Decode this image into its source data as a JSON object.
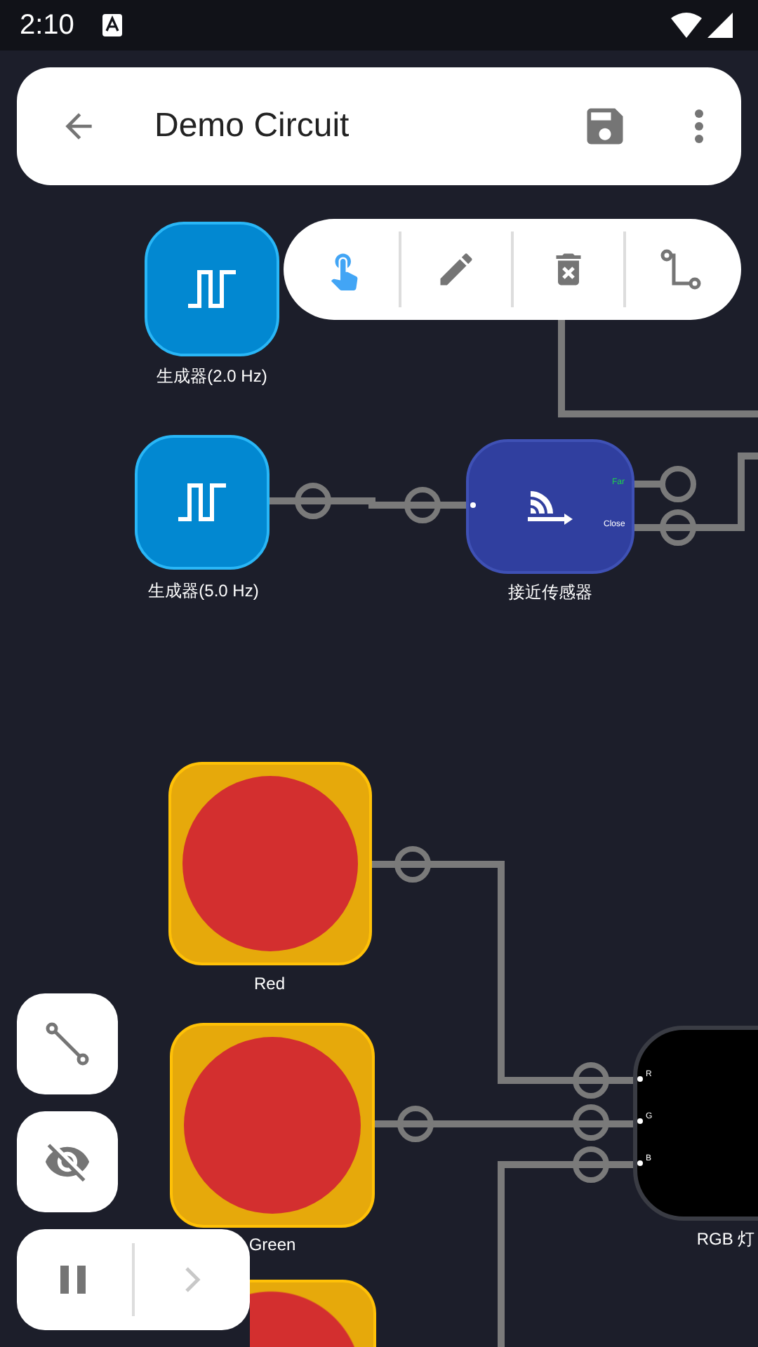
{
  "status_bar": {
    "time": "2:10"
  },
  "app_bar": {
    "title": "Demo Circuit"
  },
  "edit_tools": [
    {
      "kind": "touch",
      "selected": true
    },
    {
      "kind": "edit",
      "selected": false
    },
    {
      "kind": "delete",
      "selected": false
    },
    {
      "kind": "connect",
      "selected": false
    }
  ],
  "nodes": [
    {
      "kind": "generator",
      "label": "生成器(2.0 Hz)"
    },
    {
      "kind": "generator",
      "label": "生成器(5.0 Hz)"
    },
    {
      "kind": "sensor",
      "label": "接近传感器",
      "outputs": [
        {
          "name": "Far",
          "active": true
        },
        {
          "name": "Close",
          "active": false
        }
      ]
    },
    {
      "kind": "light",
      "label": "Red"
    },
    {
      "kind": "light",
      "label": "Green"
    },
    {
      "kind": "light"
    },
    {
      "kind": "rgb",
      "label": "RGB 灯",
      "inputs": [
        "R",
        "G",
        "B"
      ]
    }
  ],
  "side_buttons": [
    {
      "kind": "wire"
    },
    {
      "kind": "hide"
    }
  ],
  "playback": {
    "next_disabled": true
  }
}
